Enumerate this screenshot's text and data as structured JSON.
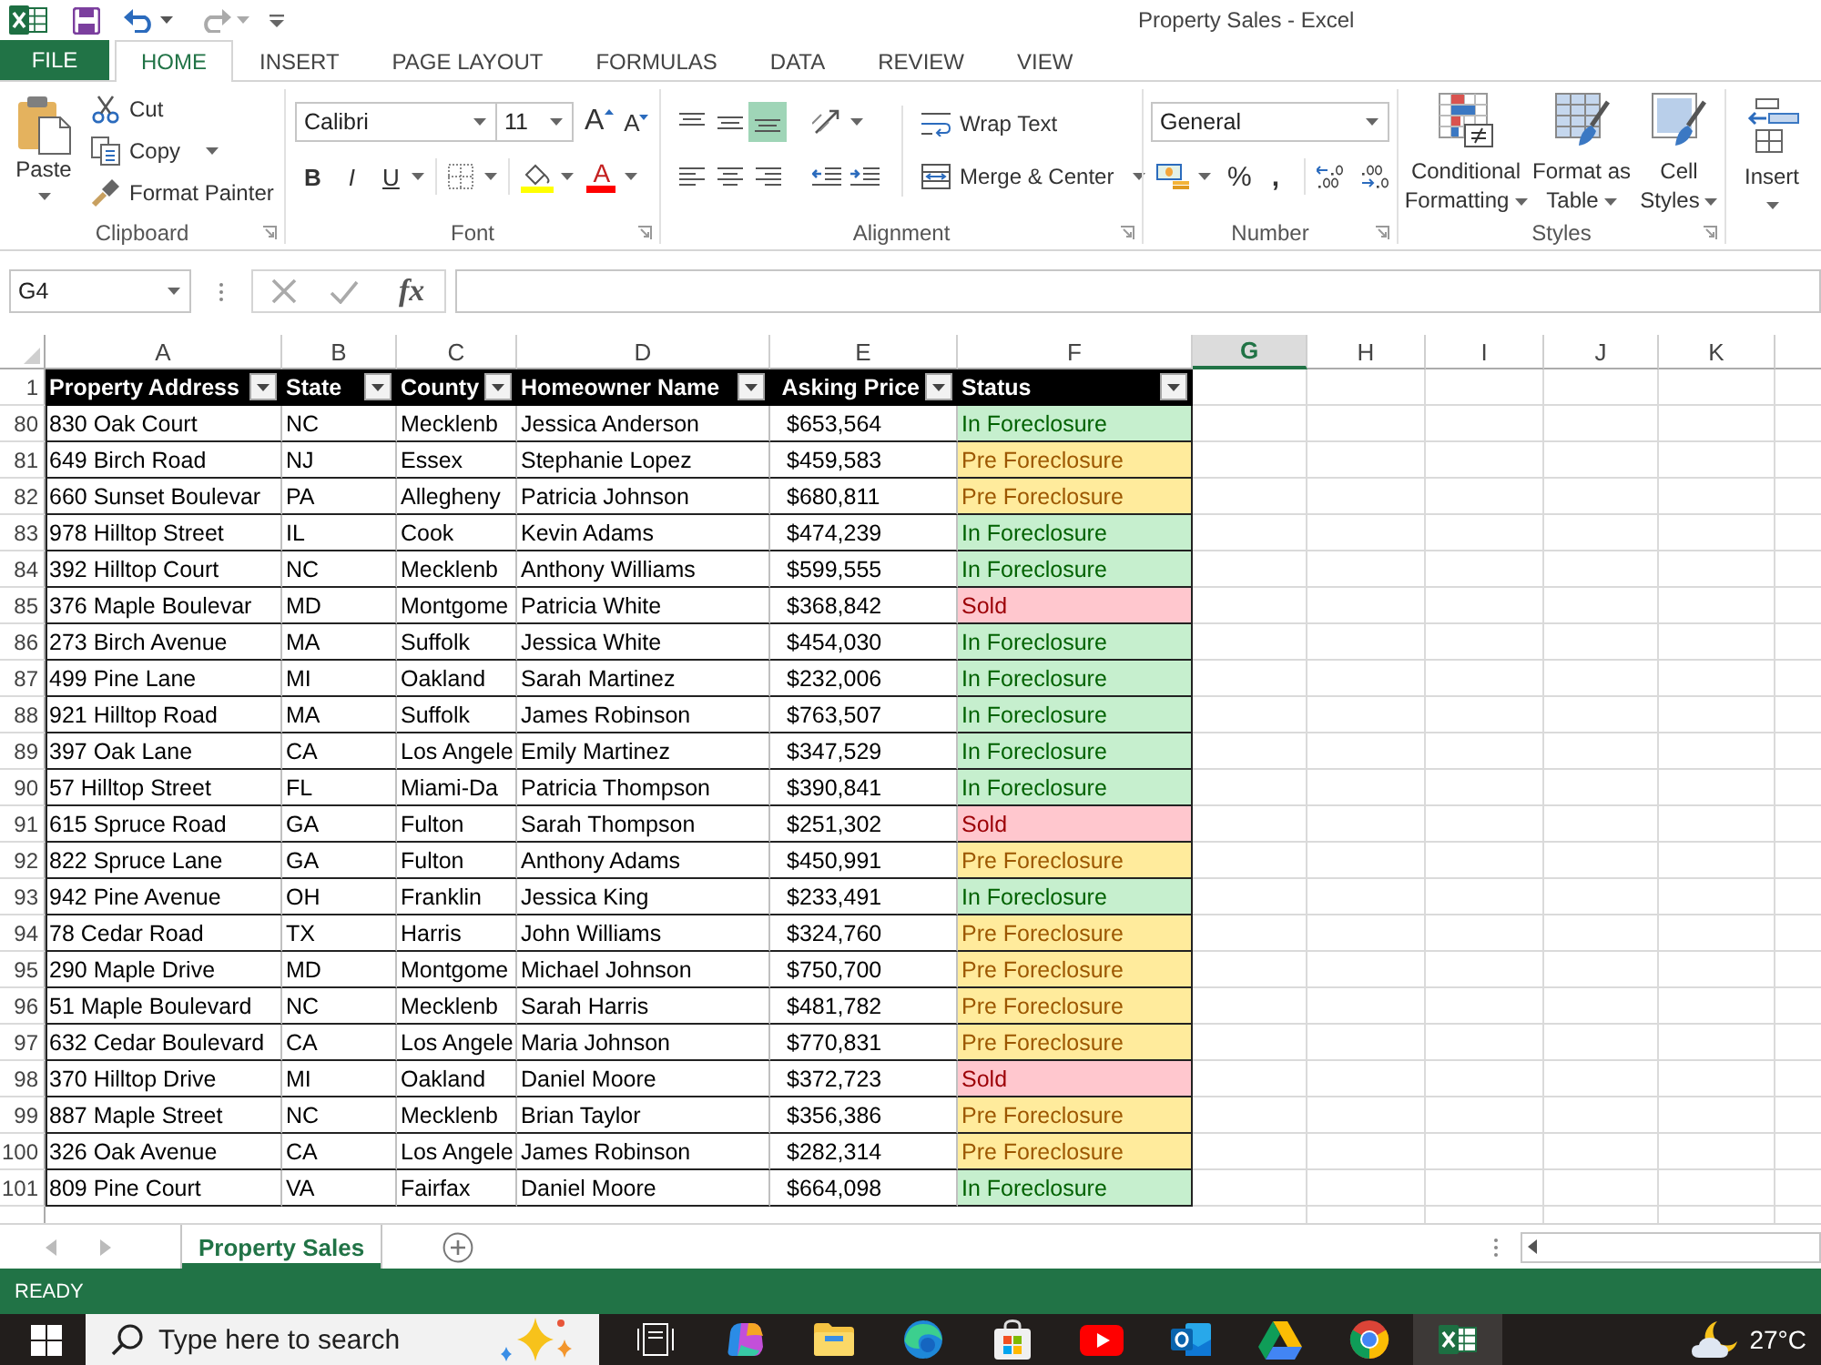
{
  "window": {
    "title": "Property Sales - Excel"
  },
  "ribbon_tabs": [
    {
      "label": "FILE",
      "kind": "file",
      "selected": false
    },
    {
      "label": "HOME",
      "kind": "tab",
      "selected": true
    },
    {
      "label": "INSERT",
      "kind": "tab",
      "selected": false
    },
    {
      "label": "PAGE LAYOUT",
      "kind": "tab",
      "selected": false
    },
    {
      "label": "FORMULAS",
      "kind": "tab",
      "selected": false
    },
    {
      "label": "DATA",
      "kind": "tab",
      "selected": false
    },
    {
      "label": "REVIEW",
      "kind": "tab",
      "selected": false
    },
    {
      "label": "VIEW",
      "kind": "tab",
      "selected": false
    }
  ],
  "ribbon": {
    "clipboard": {
      "paste": "Paste",
      "cut": "Cut",
      "copy": "Copy",
      "format_painter": "Format Painter",
      "label": "Clipboard"
    },
    "font": {
      "font_name": "Calibri",
      "font_size": "11",
      "grow_font": "A",
      "shrink_font": "A",
      "bold": "B",
      "italic": "I",
      "underline": "U",
      "font_color": "A",
      "label": "Font"
    },
    "alignment": {
      "vertical": [
        {
          "kind": "top",
          "selected": false
        },
        {
          "kind": "middle",
          "selected": false
        },
        {
          "kind": "bottom",
          "selected": true
        }
      ],
      "horizontal": [
        {
          "kind": "left",
          "selected": false
        },
        {
          "kind": "center",
          "selected": false
        },
        {
          "kind": "right",
          "selected": false
        }
      ],
      "wrap_text": "Wrap Text",
      "merge": "Merge & Center",
      "label": "Alignment"
    },
    "number": {
      "format": "General",
      "percent": "%",
      "comma": ",",
      "label": "Number"
    },
    "styles": {
      "buttons": [
        "Conditional Formatting",
        "Format as Table",
        "Cell Styles"
      ],
      "label": "Styles"
    },
    "cells": {
      "insert": "Insert"
    }
  },
  "formula_bar": {
    "name_box": "G4",
    "function_label": "fx"
  },
  "columns": [
    {
      "letter": "A",
      "selected": false
    },
    {
      "letter": "B",
      "selected": false
    },
    {
      "letter": "C",
      "selected": false
    },
    {
      "letter": "D",
      "selected": false
    },
    {
      "letter": "E",
      "selected": false
    },
    {
      "letter": "F",
      "selected": false
    },
    {
      "letter": "G",
      "selected": true
    },
    {
      "letter": "H",
      "selected": false
    },
    {
      "letter": "I",
      "selected": false
    },
    {
      "letter": "J",
      "selected": false
    },
    {
      "letter": "K",
      "selected": false
    }
  ],
  "table": {
    "header_row_number": "1",
    "headers": [
      "Property Address",
      "State",
      "County",
      "Homeowner Name",
      "Asking Price",
      "Status"
    ],
    "rows": [
      {
        "number": "80",
        "cells": [
          "830 Oak Court",
          "NC",
          "Mecklenb",
          "Jessica Anderson",
          "$653,564"
        ],
        "status": {
          "text": "In Foreclosure",
          "kind": "good"
        }
      },
      {
        "number": "81",
        "cells": [
          "649 Birch Road",
          "NJ",
          "Essex",
          "Stephanie Lopez",
          "$459,583"
        ],
        "status": {
          "text": "Pre Foreclosure",
          "kind": "neutral"
        }
      },
      {
        "number": "82",
        "cells": [
          "660 Sunset Boulevar",
          "PA",
          "Allegheny",
          "Patricia Johnson",
          "$680,811"
        ],
        "status": {
          "text": "Pre Foreclosure",
          "kind": "neutral"
        }
      },
      {
        "number": "83",
        "cells": [
          "978 Hilltop Street",
          "IL",
          "Cook",
          "Kevin Adams",
          "$474,239"
        ],
        "status": {
          "text": "In Foreclosure",
          "kind": "good"
        }
      },
      {
        "number": "84",
        "cells": [
          "392 Hilltop Court",
          "NC",
          "Mecklenb",
          "Anthony Williams",
          "$599,555"
        ],
        "status": {
          "text": "In Foreclosure",
          "kind": "good"
        }
      },
      {
        "number": "85",
        "cells": [
          "376 Maple Boulevar",
          "MD",
          "Montgome",
          "Patricia White",
          "$368,842"
        ],
        "status": {
          "text": "Sold",
          "kind": "bad"
        }
      },
      {
        "number": "86",
        "cells": [
          "273 Birch Avenue",
          "MA",
          "Suffolk",
          "Jessica White",
          "$454,030"
        ],
        "status": {
          "text": "In Foreclosure",
          "kind": "good"
        }
      },
      {
        "number": "87",
        "cells": [
          "499 Pine Lane",
          "MI",
          "Oakland",
          "Sarah Martinez",
          "$232,006"
        ],
        "status": {
          "text": "In Foreclosure",
          "kind": "good"
        }
      },
      {
        "number": "88",
        "cells": [
          "921 Hilltop Road",
          "MA",
          "Suffolk",
          "James Robinson",
          "$763,507"
        ],
        "status": {
          "text": "In Foreclosure",
          "kind": "good"
        }
      },
      {
        "number": "89",
        "cells": [
          "397 Oak Lane",
          "CA",
          "Los Angele",
          "Emily Martinez",
          "$347,529"
        ],
        "status": {
          "text": "In Foreclosure",
          "kind": "good"
        }
      },
      {
        "number": "90",
        "cells": [
          "57 Hilltop Street",
          "FL",
          "Miami-Da",
          "Patricia Thompson",
          "$390,841"
        ],
        "status": {
          "text": "In Foreclosure",
          "kind": "good"
        }
      },
      {
        "number": "91",
        "cells": [
          "615 Spruce Road",
          "GA",
          "Fulton",
          "Sarah Thompson",
          "$251,302"
        ],
        "status": {
          "text": "Sold",
          "kind": "bad"
        }
      },
      {
        "number": "92",
        "cells": [
          "822 Spruce Lane",
          "GA",
          "Fulton",
          "Anthony Adams",
          "$450,991"
        ],
        "status": {
          "text": "Pre Foreclosure",
          "kind": "neutral"
        }
      },
      {
        "number": "93",
        "cells": [
          "942 Pine Avenue",
          "OH",
          "Franklin",
          "Jessica King",
          "$233,491"
        ],
        "status": {
          "text": "In Foreclosure",
          "kind": "good"
        }
      },
      {
        "number": "94",
        "cells": [
          "78 Cedar Road",
          "TX",
          "Harris",
          "John Williams",
          "$324,760"
        ],
        "status": {
          "text": "Pre Foreclosure",
          "kind": "neutral"
        }
      },
      {
        "number": "95",
        "cells": [
          "290 Maple Drive",
          "MD",
          "Montgome",
          "Michael Johnson",
          "$750,700"
        ],
        "status": {
          "text": "Pre Foreclosure",
          "kind": "neutral"
        }
      },
      {
        "number": "96",
        "cells": [
          "51 Maple Boulevard",
          "NC",
          "Mecklenb",
          "Sarah Harris",
          "$481,782"
        ],
        "status": {
          "text": "Pre Foreclosure",
          "kind": "neutral"
        }
      },
      {
        "number": "97",
        "cells": [
          "632 Cedar Boulevard",
          "CA",
          "Los Angele",
          "Maria Johnson",
          "$770,831"
        ],
        "status": {
          "text": "Pre Foreclosure",
          "kind": "neutral"
        }
      },
      {
        "number": "98",
        "cells": [
          "370 Hilltop Drive",
          "MI",
          "Oakland",
          "Daniel Moore",
          "$372,723"
        ],
        "status": {
          "text": "Sold",
          "kind": "bad"
        }
      },
      {
        "number": "99",
        "cells": [
          "887 Maple Street",
          "NC",
          "Mecklenb",
          "Brian Taylor",
          "$356,386"
        ],
        "status": {
          "text": "Pre Foreclosure",
          "kind": "neutral"
        }
      },
      {
        "number": "100",
        "cells": [
          "326 Oak Avenue",
          "CA",
          "Los Angele",
          "James Robinson",
          "$282,314"
        ],
        "status": {
          "text": "Pre Foreclosure",
          "kind": "neutral"
        }
      },
      {
        "number": "101",
        "cells": [
          "809 Pine Court",
          "VA",
          "Fairfax",
          "Daniel Moore",
          "$664,098"
        ],
        "status": {
          "text": "In Foreclosure",
          "kind": "good"
        }
      }
    ]
  },
  "sheet_tabs": [
    {
      "label": "Property Sales",
      "selected": true
    }
  ],
  "status_bar": {
    "text": "READY"
  },
  "taskbar": {
    "search_placeholder": "Type here to search",
    "apps": [
      {
        "active": false
      },
      {
        "active": false
      },
      {
        "active": false
      },
      {
        "active": false
      },
      {
        "active": false
      },
      {
        "active": false
      },
      {
        "active": false
      },
      {
        "active": false
      },
      {
        "active": false
      },
      {
        "active": true
      }
    ],
    "temperature": "27°C"
  }
}
